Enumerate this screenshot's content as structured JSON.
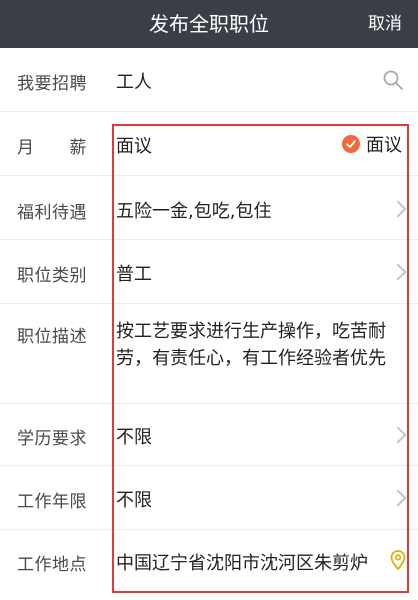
{
  "header": {
    "title": "发布全职职位",
    "cancel_label": "取消"
  },
  "form": {
    "job": {
      "label": "我要招聘",
      "value": "工人"
    },
    "salary": {
      "label": "月　　薪",
      "value": "面议",
      "negotiable_label": "面议",
      "negotiable_checked": true
    },
    "benefits": {
      "label": "福利待遇",
      "value": "五险一金,包吃,包住"
    },
    "category": {
      "label": "职位类别",
      "value": "普工"
    },
    "description": {
      "label": "职位描述",
      "value": "按工艺要求进行生产操作，吃苦耐劳，有责任心，有工作经验者优先"
    },
    "education": {
      "label": "学历要求",
      "value": "不限"
    },
    "experience": {
      "label": "工作年限",
      "value": "不限"
    },
    "location": {
      "label": "工作地点",
      "value": "中国辽宁省沈阳市沈河区朱剪炉"
    }
  },
  "colors": {
    "header_bg": "#3a3f47",
    "accent": "#f06a3c",
    "highlight_border": "#e53935",
    "location_icon": "#e0b000"
  },
  "icons": {
    "search": "search-icon",
    "check": "check-circle-icon",
    "chevron": "chevron-right-icon",
    "location": "location-pin-icon"
  }
}
